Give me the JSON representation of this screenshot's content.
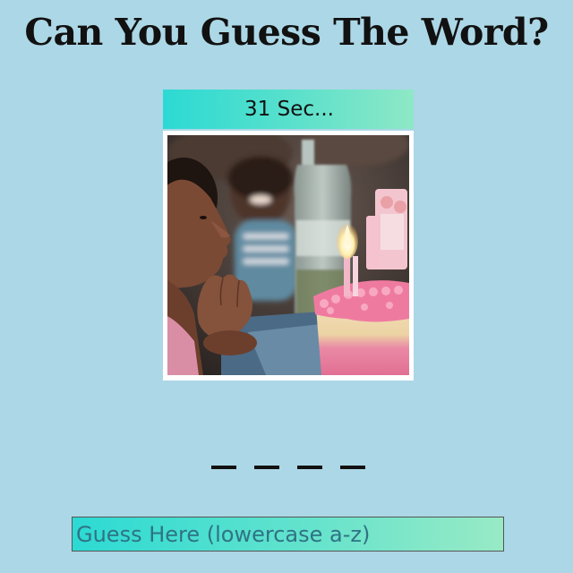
{
  "game": {
    "title": "Can You Guess The Word?",
    "timer_text": "31 Sec...",
    "blank_count": 4
  },
  "image": {
    "subject": "child blowing candles on birthday cake",
    "alt": ""
  },
  "guess": {
    "value": "",
    "placeholder": "Guess Here (lowercase a-z)"
  },
  "colors": {
    "background": "#acd7e6",
    "gradient_start": "#2cdad3",
    "gradient_end": "#8ee8c6",
    "text": "#111111"
  }
}
